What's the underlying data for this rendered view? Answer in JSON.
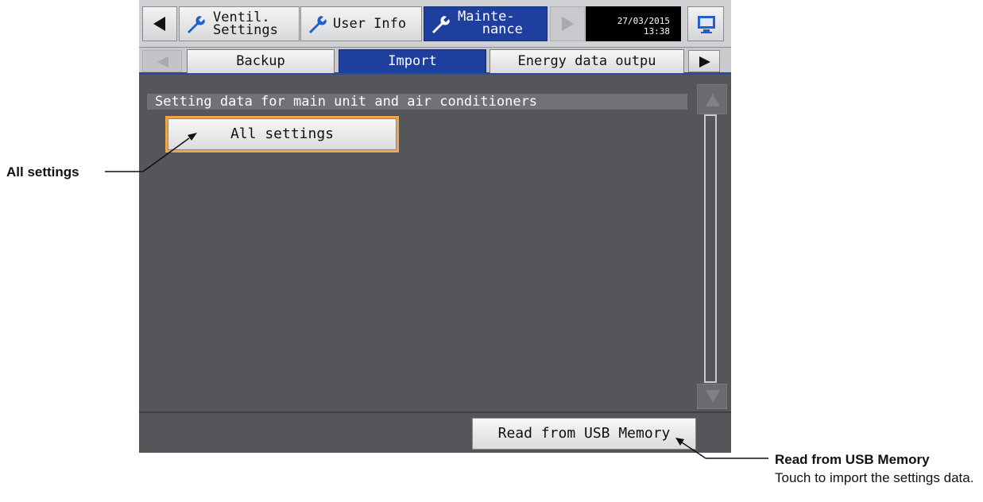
{
  "header": {
    "tabs": [
      {
        "label": "Ventil.\nSettings"
      },
      {
        "label": "User Info"
      },
      {
        "label": "Mainte-\n   nance"
      }
    ],
    "clock": {
      "date": "27/03/2015",
      "time": "13:38"
    }
  },
  "subtabs": [
    {
      "label": "Backup"
    },
    {
      "label": "Import"
    },
    {
      "label": "Energy data outpu"
    }
  ],
  "content": {
    "section_title": "Setting data for main unit and air conditioners",
    "all_settings_label": "All settings"
  },
  "footer": {
    "read_usb_label": "Read from USB Memory"
  },
  "annotations": {
    "all_settings": "All settings",
    "read_usb_title": "Read from USB Memory",
    "read_usb_desc": "Touch to import the settings data."
  },
  "colors": {
    "active_tab": "#1f3f9e",
    "highlight": "#f1a44a",
    "panel": "#55565a"
  },
  "icons": [
    "arrow-left-icon",
    "wrench-icon",
    "arrow-right-icon",
    "monitor-icon",
    "scroll-up-icon",
    "scroll-down-icon"
  ]
}
